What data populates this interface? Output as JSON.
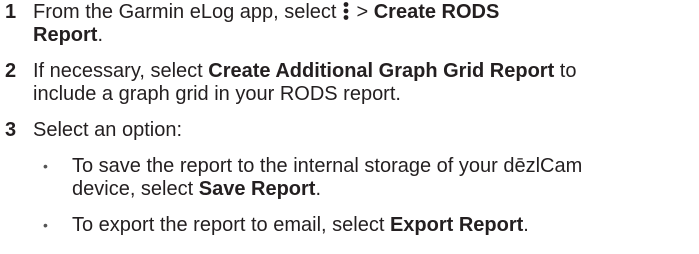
{
  "steps": [
    {
      "number": "1",
      "line1_pre": "From the Garmin eLog app, select",
      "icon": "vertical-ellipsis-menu-icon",
      "line1_mid": "> ",
      "line1_bold": "Create RODS",
      "line2_bold": "Report",
      "line2_post": "."
    },
    {
      "number": "2",
      "line1_pre": "If necessary, select ",
      "line1_bold": "Create Additional Graph Grid Report",
      "line1_post": " to",
      "line2": "include a graph grid in your RODS report."
    },
    {
      "number": "3",
      "line1": "Select an option:"
    }
  ],
  "bullets": [
    {
      "line1": "To save the report to the internal storage of your dēzlCam",
      "line2_pre": "device, select ",
      "line2_bold": "Save Report",
      "line2_post": "."
    },
    {
      "line1_pre": "To export the report to email, select ",
      "line1_bold": "Export Report",
      "line1_post": "."
    }
  ]
}
